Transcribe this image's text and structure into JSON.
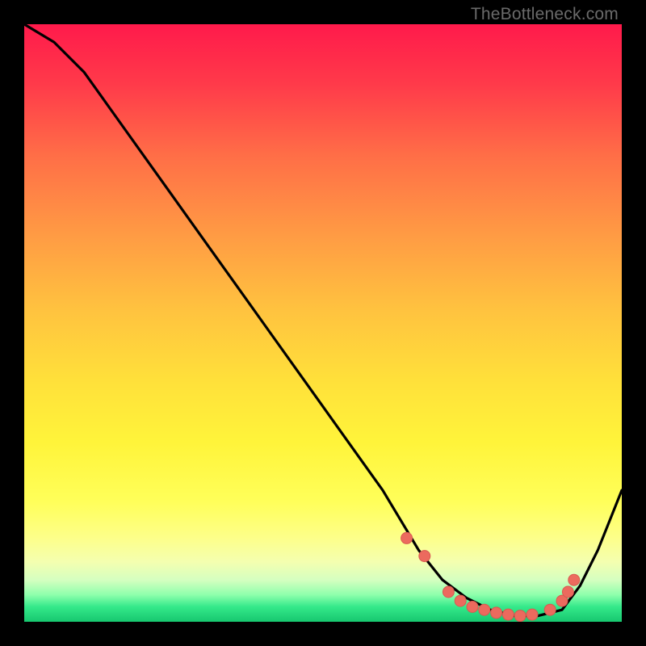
{
  "watermark": "TheBottleneck.com",
  "colors": {
    "black": "#000000",
    "curve": "#000000",
    "marker_fill": "#ec6a5e",
    "marker_stroke": "#d85a50",
    "gradient_stops": [
      {
        "offset": 0.0,
        "color": "#ff1a4b"
      },
      {
        "offset": 0.1,
        "color": "#ff3a4a"
      },
      {
        "offset": 0.22,
        "color": "#ff6e47"
      },
      {
        "offset": 0.35,
        "color": "#ff9a44"
      },
      {
        "offset": 0.48,
        "color": "#ffc33f"
      },
      {
        "offset": 0.6,
        "color": "#ffe13a"
      },
      {
        "offset": 0.7,
        "color": "#fff43a"
      },
      {
        "offset": 0.8,
        "color": "#ffff5a"
      },
      {
        "offset": 0.86,
        "color": "#fdff8a"
      },
      {
        "offset": 0.9,
        "color": "#f4ffb0"
      },
      {
        "offset": 0.93,
        "color": "#d5ffc0"
      },
      {
        "offset": 0.955,
        "color": "#8effac"
      },
      {
        "offset": 0.975,
        "color": "#34e98a"
      },
      {
        "offset": 1.0,
        "color": "#17c76f"
      }
    ]
  },
  "chart_data": {
    "type": "line",
    "title": "",
    "xlabel": "",
    "ylabel": "",
    "xlim": [
      0,
      100
    ],
    "ylim": [
      0,
      100
    ],
    "grid": false,
    "legend": false,
    "series": [
      {
        "name": "bottleneck-curve",
        "x": [
          0,
          5,
          10,
          15,
          20,
          25,
          30,
          35,
          40,
          45,
          50,
          55,
          60,
          63,
          66,
          70,
          74,
          78,
          82,
          86,
          90,
          93,
          96,
          100
        ],
        "y": [
          100,
          97,
          92,
          85,
          78,
          71,
          64,
          57,
          50,
          43,
          36,
          29,
          22,
          17,
          12,
          7,
          4,
          2,
          1,
          1,
          2,
          6,
          12,
          22
        ]
      }
    ],
    "markers": {
      "name": "highlight-dots",
      "x": [
        64,
        67,
        71,
        73,
        75,
        77,
        79,
        81,
        83,
        85,
        88,
        90,
        91,
        92
      ],
      "y": [
        14,
        11,
        5,
        3.5,
        2.5,
        2,
        1.5,
        1.2,
        1,
        1.2,
        2,
        3.5,
        5,
        7
      ]
    }
  }
}
